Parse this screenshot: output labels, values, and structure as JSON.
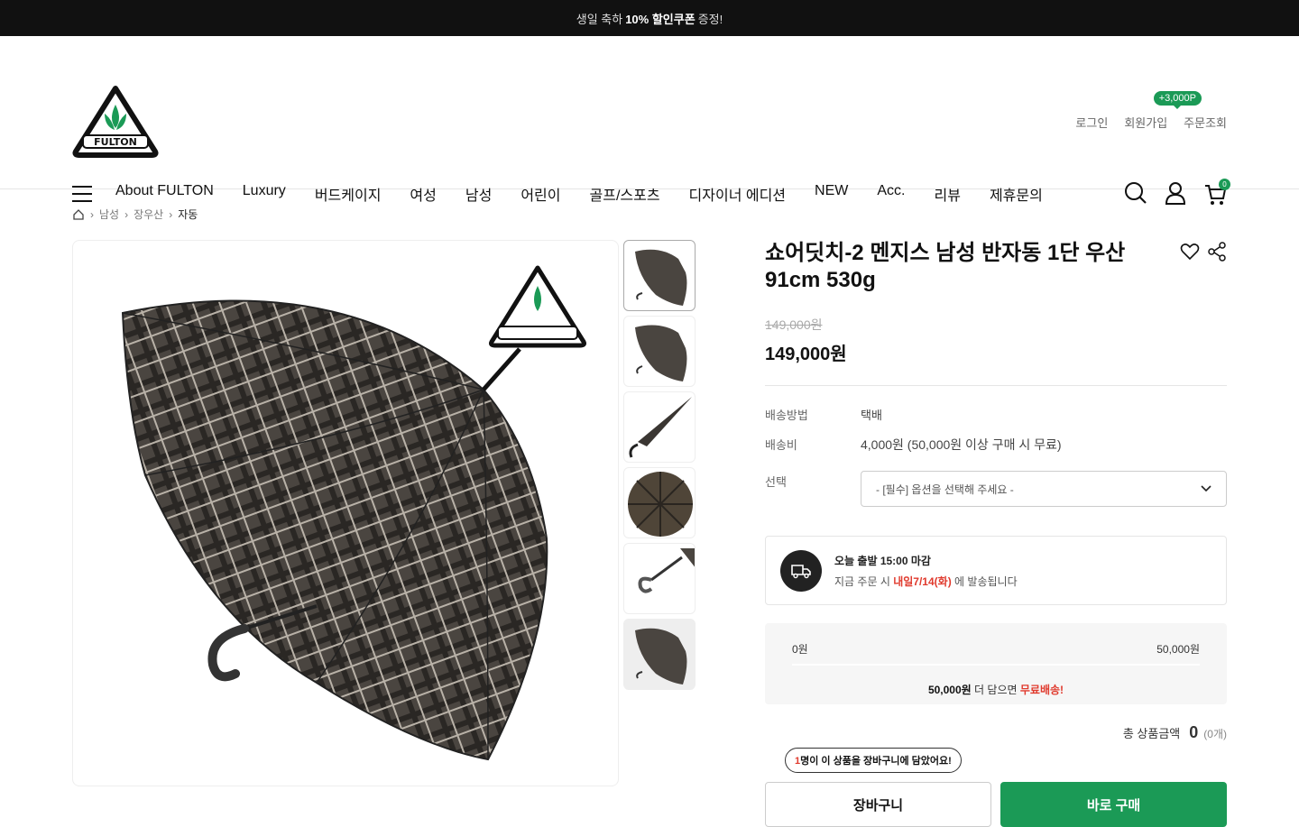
{
  "topbar": {
    "pre": "생일 축하",
    "bold": "10% 할인쿠폰",
    "post": "증정!"
  },
  "logo": {
    "text": "FULTON"
  },
  "util": {
    "login": "로그인",
    "join": "회원가입",
    "order": "주문조회",
    "point_badge": "+3,000P"
  },
  "nav": {
    "items": [
      "About FULTON",
      "Luxury",
      "버드케이지",
      "여성",
      "남성",
      "어린이",
      "골프/스포츠",
      "디자이너 에디션",
      "NEW",
      "Acc.",
      "리뷰",
      "제휴문의"
    ]
  },
  "cart": {
    "count": "0"
  },
  "breadcrumb": {
    "items": [
      "남성",
      "장우산",
      "자동"
    ]
  },
  "product": {
    "title": "쇼어딧치-2 멘지스 남성 반자동 1단 우산 91cm 530g",
    "price_old": "149,000원",
    "price": "149,000원",
    "shipping_method_label": "배송방법",
    "shipping_method": "택배",
    "shipping_fee_label": "배송비",
    "shipping_fee": "4,000원 (50,000원 이상 구매 시 무료)",
    "option_label": "선택",
    "option_placeholder": "- [필수] 옵션을 선택해 주세요 -"
  },
  "dispatch": {
    "title": "오늘 출발 15:00 마감",
    "pre": "지금 주문 시",
    "highlight": "내일7/14(화)",
    "post": "에 발송됩니다"
  },
  "free_ship": {
    "min": "0원",
    "max": "50,000원",
    "amount": "50,000원",
    "mid": "더 담으면",
    "red": "무료배송!"
  },
  "total": {
    "label": "총 상품금액",
    "amount": "0",
    "count": "(0개)"
  },
  "tooltip": {
    "num": "1",
    "text": "명이 이 상품을 장바구니에 담았어요!"
  },
  "buttons": {
    "cart": "장바구니",
    "buy": "바로 구매"
  },
  "colors": {
    "brand": "#1b9a56",
    "accent": "#e03a2d"
  }
}
